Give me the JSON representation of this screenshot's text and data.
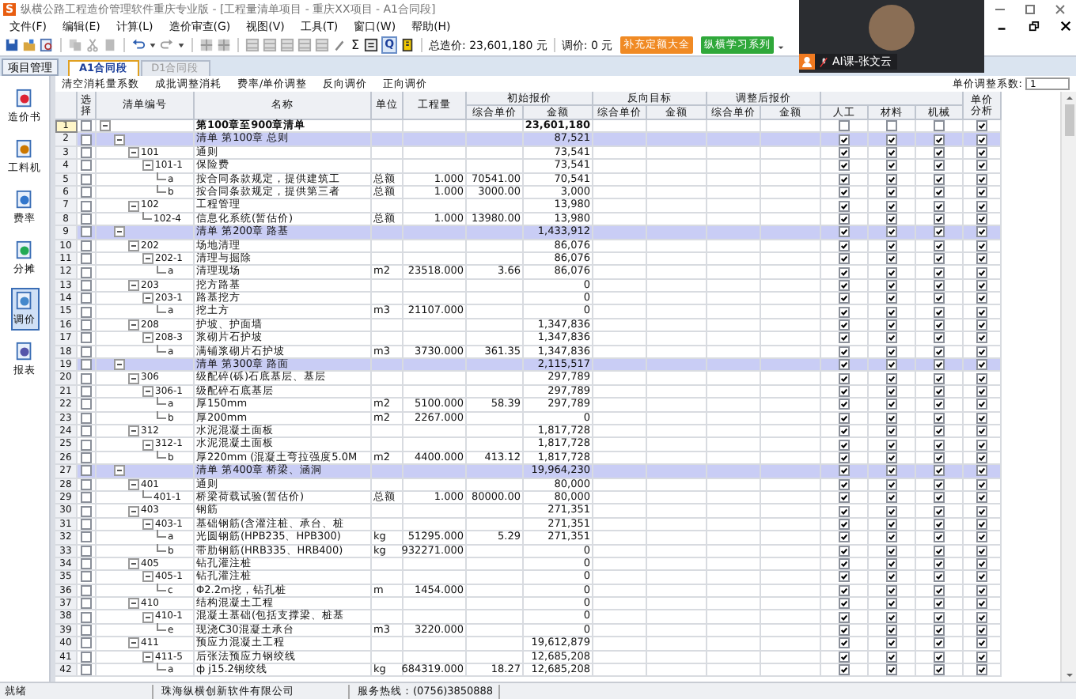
{
  "window": {
    "logo": "S",
    "title": "纵横公路工程造价管理软件重庆专业版 - [工程量清单项目 - 重庆XX项目 - A1合同段]"
  },
  "menu": [
    "文件(F)",
    "编辑(E)",
    "计算(L)",
    "造价审查(G)",
    "视图(V)",
    "工具(T)",
    "窗口(W)",
    "帮助(H)"
  ],
  "toolbar": {
    "sigma": "Σ",
    "q": "Q",
    "total": "总造价: 23,601,180 元",
    "adjust": "调价: 0 元",
    "buttons": [
      {
        "label": "补充定额大全",
        "color": "#f08a24"
      },
      {
        "label": "纵横学习系列",
        "color": "#2fa83a"
      }
    ]
  },
  "project_button": "项目管理",
  "tabs": [
    {
      "label": "A1合同段",
      "selected": true
    },
    {
      "label": "D1合同段",
      "selected": false
    }
  ],
  "sidebar": {
    "items": [
      {
        "label": "造价书",
        "selected": false
      },
      {
        "label": "工料机",
        "selected": false
      },
      {
        "label": "费率",
        "selected": false
      },
      {
        "label": "分摊",
        "selected": false
      },
      {
        "label": "调价",
        "selected": true
      },
      {
        "label": "报表",
        "selected": false
      }
    ]
  },
  "subtoolbar": {
    "items": [
      "清空消耗量系数",
      "成批调整消耗",
      "费率/单价调整",
      "反向调价",
      "正向调价"
    ],
    "coef_label": "单价调整系数:",
    "coef_value": "1"
  },
  "table": {
    "header": {
      "select": "选择",
      "code": "清单编号",
      "name": "名称",
      "unit": "单位",
      "qty": "工程量",
      "groups": [
        {
          "label": "初始报价",
          "sub": [
            "综合单价",
            "金额"
          ]
        },
        {
          "label": "反向目标",
          "sub": [
            "综合单价",
            "金额"
          ]
        },
        {
          "label": "调整后报价",
          "sub": [
            "综合单价",
            "金额"
          ]
        }
      ],
      "labor": "人工",
      "material": "材料",
      "machine": "机械",
      "analysis": "单价分析"
    },
    "rows": [
      {
        "no": "1",
        "name": "第100章至900章清单",
        "amount": "23,601,180",
        "highlighted": false,
        "selected": true,
        "select": false,
        "labor": false,
        "material": false,
        "machine": false,
        "analysis": true,
        "children": [
          {
            "no": "2",
            "name": "清单 第100章  总则",
            "amount": "87,521",
            "highlighted": true,
            "selected": false,
            "select": false,
            "labor": true,
            "material": true,
            "machine": true,
            "analysis": true,
            "children": [
              {
                "no": "3",
                "code": "101",
                "name": "通则",
                "amount": "73,541",
                "highlighted": false,
                "selected": false,
                "select": false,
                "labor": true,
                "material": true,
                "machine": true,
                "analysis": true,
                "children": [
                  {
                    "no": "4",
                    "code": "101-1",
                    "name": "保险费",
                    "amount": "73,541",
                    "highlighted": false,
                    "selected": false,
                    "select": false,
                    "labor": true,
                    "material": true,
                    "machine": true,
                    "analysis": true,
                    "children": [
                      {
                        "no": "5",
                        "code": "a",
                        "name": "按合同条款规定，提供建筑工",
                        "unit": "总额",
                        "qty": "1.000",
                        "price": "70541.00",
                        "amount": "70,541",
                        "highlighted": false,
                        "selected": false,
                        "select": false,
                        "labor": true,
                        "material": true,
                        "machine": true,
                        "analysis": true
                      },
                      {
                        "no": "6",
                        "code": "b",
                        "name": "按合同条款规定，提供第三者",
                        "unit": "总额",
                        "qty": "1.000",
                        "price": "3000.00",
                        "amount": "3,000",
                        "highlighted": false,
                        "selected": false,
                        "select": false,
                        "labor": true,
                        "material": true,
                        "machine": true,
                        "analysis": true
                      }
                    ]
                  }
                ]
              },
              {
                "no": "7",
                "code": "102",
                "name": "工程管理",
                "amount": "13,980",
                "highlighted": false,
                "selected": false,
                "select": false,
                "labor": true,
                "material": true,
                "machine": true,
                "analysis": true,
                "children": [
                  {
                    "no": "8",
                    "code": "102-4",
                    "name": "信息化系统(暂估价)",
                    "unit": "总额",
                    "qty": "1.000",
                    "price": "13980.00",
                    "amount": "13,980",
                    "highlighted": false,
                    "selected": false,
                    "select": false,
                    "labor": true,
                    "material": true,
                    "machine": true,
                    "analysis": true
                  }
                ]
              }
            ]
          },
          {
            "no": "9",
            "name": "清单 第200章  路基",
            "amount": "1,433,912",
            "highlighted": true,
            "selected": false,
            "select": false,
            "labor": true,
            "material": true,
            "machine": true,
            "analysis": true,
            "children": [
              {
                "no": "10",
                "code": "202",
                "name": "场地清理",
                "amount": "86,076",
                "highlighted": false,
                "selected": false,
                "select": false,
                "labor": true,
                "material": true,
                "machine": true,
                "analysis": true,
                "children": [
                  {
                    "no": "11",
                    "code": "202-1",
                    "name": "清理与掘除",
                    "amount": "86,076",
                    "highlighted": false,
                    "selected": false,
                    "select": false,
                    "labor": true,
                    "material": true,
                    "machine": true,
                    "analysis": true,
                    "children": [
                      {
                        "no": "12",
                        "code": "a",
                        "name": "清理现场",
                        "unit": "m2",
                        "qty": "23518.000",
                        "price": "3.66",
                        "amount": "86,076",
                        "highlighted": false,
                        "selected": false,
                        "select": false,
                        "labor": true,
                        "material": true,
                        "machine": true,
                        "analysis": true
                      }
                    ]
                  }
                ]
              },
              {
                "no": "13",
                "code": "203",
                "name": "挖方路基",
                "amount": "0",
                "highlighted": false,
                "selected": false,
                "select": false,
                "labor": true,
                "material": true,
                "machine": true,
                "analysis": true,
                "children": [
                  {
                    "no": "14",
                    "code": "203-1",
                    "name": "路基挖方",
                    "amount": "0",
                    "highlighted": false,
                    "selected": false,
                    "select": false,
                    "labor": true,
                    "material": true,
                    "machine": true,
                    "analysis": true,
                    "children": [
                      {
                        "no": "15",
                        "code": "a",
                        "name": "挖土方",
                        "unit": "m3",
                        "qty": "21107.000",
                        "amount": "0",
                        "highlighted": false,
                        "selected": false,
                        "select": false,
                        "labor": true,
                        "material": true,
                        "machine": true,
                        "analysis": true
                      }
                    ]
                  }
                ]
              },
              {
                "no": "16",
                "code": "208",
                "name": "护坡、护面墙",
                "amount": "1,347,836",
                "highlighted": false,
                "selected": false,
                "select": false,
                "labor": true,
                "material": true,
                "machine": true,
                "analysis": true,
                "children": [
                  {
                    "no": "17",
                    "code": "208-3",
                    "name": "浆砌片石护坡",
                    "amount": "1,347,836",
                    "highlighted": false,
                    "selected": false,
                    "select": false,
                    "labor": true,
                    "material": true,
                    "machine": true,
                    "analysis": true,
                    "children": [
                      {
                        "no": "18",
                        "code": "a",
                        "name": "满铺浆砌片石护坡",
                        "unit": "m3",
                        "qty": "3730.000",
                        "price": "361.35",
                        "amount": "1,347,836",
                        "highlighted": false,
                        "selected": false,
                        "select": false,
                        "labor": true,
                        "material": true,
                        "machine": true,
                        "analysis": true
                      }
                    ]
                  }
                ]
              }
            ]
          },
          {
            "no": "19",
            "name": "清单 第300章  路面",
            "amount": "2,115,517",
            "highlighted": true,
            "selected": false,
            "select": false,
            "labor": true,
            "material": true,
            "machine": true,
            "analysis": true,
            "children": [
              {
                "no": "20",
                "code": "306",
                "name": "级配碎(砾)石底基层、基层",
                "amount": "297,789",
                "highlighted": false,
                "selected": false,
                "select": false,
                "labor": true,
                "material": true,
                "machine": true,
                "analysis": true,
                "children": [
                  {
                    "no": "21",
                    "code": "306-1",
                    "name": "级配碎石底基层",
                    "amount": "297,789",
                    "highlighted": false,
                    "selected": false,
                    "select": false,
                    "labor": true,
                    "material": true,
                    "machine": true,
                    "analysis": true,
                    "children": [
                      {
                        "no": "22",
                        "code": "a",
                        "name": "厚150mm",
                        "unit": "m2",
                        "qty": "5100.000",
                        "price": "58.39",
                        "amount": "297,789",
                        "highlighted": false,
                        "selected": false,
                        "select": false,
                        "labor": true,
                        "material": true,
                        "machine": true,
                        "analysis": true
                      },
                      {
                        "no": "23",
                        "code": "b",
                        "name": "厚200mm",
                        "unit": "m2",
                        "qty": "2267.000",
                        "amount": "0",
                        "highlighted": false,
                        "selected": false,
                        "select": false,
                        "labor": true,
                        "material": true,
                        "machine": true,
                        "analysis": true
                      }
                    ]
                  }
                ]
              },
              {
                "no": "24",
                "code": "312",
                "name": "水泥混凝土面板",
                "amount": "1,817,728",
                "highlighted": false,
                "selected": false,
                "select": false,
                "labor": true,
                "material": true,
                "machine": true,
                "analysis": true,
                "children": [
                  {
                    "no": "25",
                    "code": "312-1",
                    "name": "水泥混凝土面板",
                    "amount": "1,817,728",
                    "highlighted": false,
                    "selected": false,
                    "select": false,
                    "labor": true,
                    "material": true,
                    "machine": true,
                    "analysis": true,
                    "children": [
                      {
                        "no": "26",
                        "code": "b",
                        "name": "厚220mm (混凝土弯拉强度5.0M",
                        "unit": "m2",
                        "qty": "4400.000",
                        "price": "413.12",
                        "amount": "1,817,728",
                        "highlighted": false,
                        "selected": false,
                        "select": false,
                        "labor": true,
                        "material": true,
                        "machine": true,
                        "analysis": true
                      }
                    ]
                  }
                ]
              }
            ]
          },
          {
            "no": "27",
            "name": "清单 第400章  桥梁、涵洞",
            "amount": "19,964,230",
            "highlighted": true,
            "selected": false,
            "select": false,
            "labor": true,
            "material": true,
            "machine": true,
            "analysis": true,
            "children": [
              {
                "no": "28",
                "code": "401",
                "name": "通则",
                "amount": "80,000",
                "highlighted": false,
                "selected": false,
                "select": false,
                "labor": true,
                "material": true,
                "machine": true,
                "analysis": true,
                "children": [
                  {
                    "no": "29",
                    "code": "401-1",
                    "name": "桥梁荷载试验(暂估价)",
                    "unit": "总额",
                    "qty": "1.000",
                    "price": "80000.00",
                    "amount": "80,000",
                    "highlighted": false,
                    "selected": false,
                    "select": false,
                    "labor": true,
                    "material": true,
                    "machine": true,
                    "analysis": true
                  }
                ]
              },
              {
                "no": "30",
                "code": "403",
                "name": "钢筋",
                "amount": "271,351",
                "highlighted": false,
                "selected": false,
                "select": false,
                "labor": true,
                "material": true,
                "machine": true,
                "analysis": true,
                "children": [
                  {
                    "no": "31",
                    "code": "403-1",
                    "name": "基础钢筋(含灌注桩、承台、桩",
                    "amount": "271,351",
                    "highlighted": false,
                    "selected": false,
                    "select": false,
                    "labor": true,
                    "material": true,
                    "machine": true,
                    "analysis": true,
                    "children": [
                      {
                        "no": "32",
                        "code": "a",
                        "name": "光圆钢筋(HPB235、HPB300)",
                        "unit": "kg",
                        "qty": "51295.000",
                        "price": "5.29",
                        "amount": "271,351",
                        "highlighted": false,
                        "selected": false,
                        "select": false,
                        "labor": true,
                        "material": true,
                        "machine": true,
                        "analysis": true
                      },
                      {
                        "no": "33",
                        "code": "b",
                        "name": "带肋钢筋(HRB335、HRB400)",
                        "unit": "kg",
                        "qty": "932271.000",
                        "amount": "0",
                        "highlighted": false,
                        "selected": false,
                        "select": false,
                        "labor": true,
                        "material": true,
                        "machine": true,
                        "analysis": true
                      }
                    ]
                  }
                ]
              },
              {
                "no": "34",
                "code": "405",
                "name": "钻孔灌注桩",
                "amount": "0",
                "highlighted": false,
                "selected": false,
                "select": false,
                "labor": true,
                "material": true,
                "machine": true,
                "analysis": true,
                "children": [
                  {
                    "no": "35",
                    "code": "405-1",
                    "name": "钻孔灌注桩",
                    "amount": "0",
                    "highlighted": false,
                    "selected": false,
                    "select": false,
                    "labor": true,
                    "material": true,
                    "machine": true,
                    "analysis": true,
                    "children": [
                      {
                        "no": "36",
                        "code": "c",
                        "name": "Φ2.2m挖，钻孔桩",
                        "unit": "m",
                        "qty": "1454.000",
                        "amount": "0",
                        "highlighted": false,
                        "selected": false,
                        "select": false,
                        "labor": true,
                        "material": true,
                        "machine": true,
                        "analysis": true
                      }
                    ]
                  }
                ]
              },
              {
                "no": "37",
                "code": "410",
                "name": "结构混凝土工程",
                "amount": "0",
                "highlighted": false,
                "selected": false,
                "select": false,
                "labor": true,
                "material": true,
                "machine": true,
                "analysis": true,
                "children": [
                  {
                    "no": "38",
                    "code": "410-1",
                    "name": "混凝土基础(包括支撑梁、桩基",
                    "amount": "0",
                    "highlighted": false,
                    "selected": false,
                    "select": false,
                    "labor": true,
                    "material": true,
                    "machine": true,
                    "analysis": true,
                    "children": [
                      {
                        "no": "39",
                        "code": "e",
                        "name": "现浇C30混凝土承台",
                        "unit": "m3",
                        "qty": "3220.000",
                        "amount": "0",
                        "highlighted": false,
                        "selected": false,
                        "select": false,
                        "labor": true,
                        "material": true,
                        "machine": true,
                        "analysis": true
                      }
                    ]
                  }
                ]
              },
              {
                "no": "40",
                "code": "411",
                "name": "预应力混凝土工程",
                "amount": "19,612,879",
                "highlighted": false,
                "selected": false,
                "select": false,
                "labor": true,
                "material": true,
                "machine": true,
                "analysis": true,
                "children": [
                  {
                    "no": "41",
                    "code": "411-5",
                    "name": "后张法预应力钢绞线",
                    "amount": "12,685,208",
                    "highlighted": false,
                    "selected": false,
                    "select": false,
                    "labor": true,
                    "material": true,
                    "machine": true,
                    "analysis": true,
                    "children": [
                      {
                        "no": "42",
                        "code": "a",
                        "name": "ф j15.2钢绞线",
                        "unit": "kg",
                        "qty": "684319.000",
                        "price": "18.27",
                        "amount": "12,685,208",
                        "highlighted": false,
                        "selected": false,
                        "select": false,
                        "labor": true,
                        "material": true,
                        "machine": true,
                        "analysis": true
                      }
                    ]
                  }
                ]
              }
            ]
          }
        ]
      }
    ]
  },
  "status_bar": [
    "就绪",
    "珠海纵横创新软件有限公司",
    "服务热线：(0756)3850888"
  ],
  "video_overlay": {
    "participant": "AI课-张文云"
  }
}
